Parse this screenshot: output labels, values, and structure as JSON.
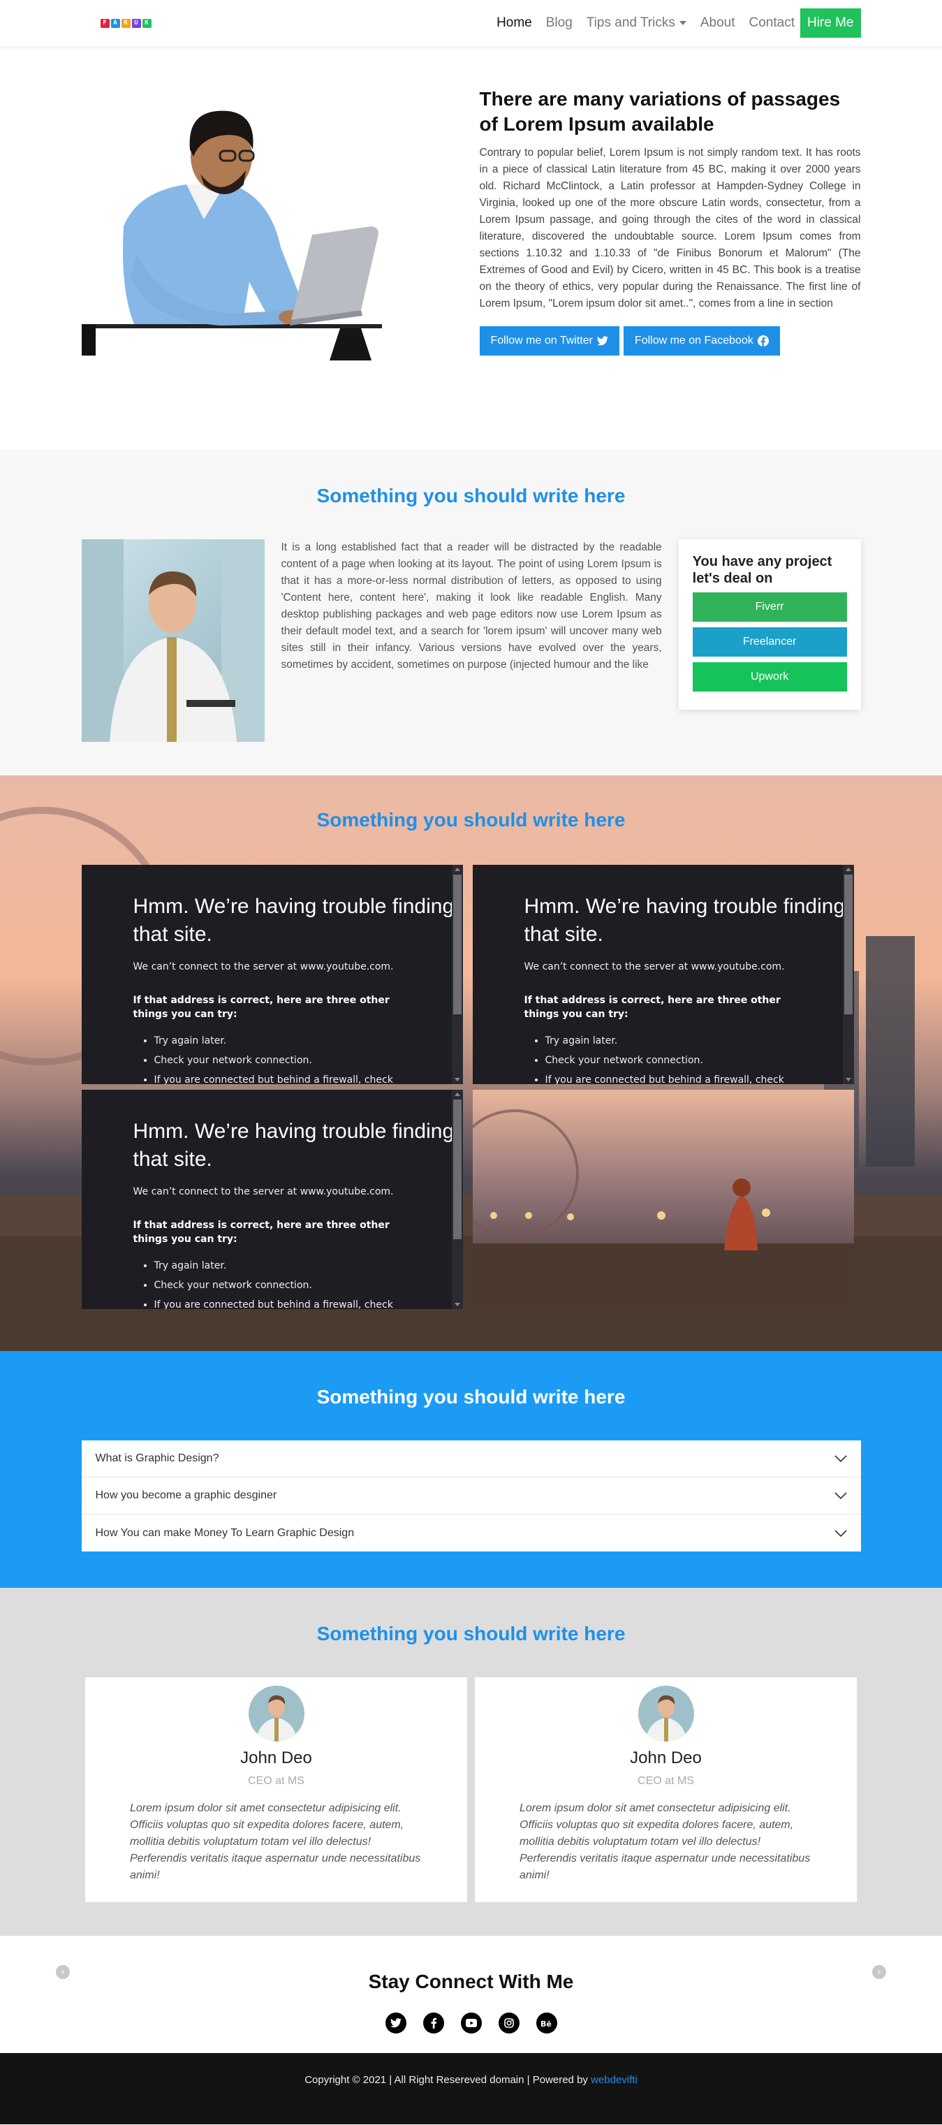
{
  "nav": {
    "logo_letters": [
      "F",
      "A",
      "R",
      "U",
      "K"
    ],
    "logo_colors": [
      "#e21f3c",
      "#1e90e8",
      "#f7a400",
      "#7a3cf0",
      "#20c25c"
    ],
    "links": [
      "Home",
      "Blog",
      "Tips and Tricks",
      "About",
      "Contact"
    ],
    "hire": "Hire Me"
  },
  "hero": {
    "title": "There are many variations of passages of Lorem Ipsum available",
    "paragraph": "Contrary to popular belief, Lorem Ipsum is not simply random text. It has roots in a piece of classical Latin literature from 45 BC, making it over 2000 years old. Richard McClintock, a Latin professor at Hampden-Sydney College in Virginia, looked up one of the more obscure Latin words, consectetur, from a Lorem Ipsum passage, and going through the cites of the word in classical literature, discovered the undoubtable source. Lorem Ipsum comes from sections 1.10.32 and 1.10.33 of \"de Finibus Bonorum et Malorum\" (The Extremes of Good and Evil) by Cicero, written in 45 BC. This book is a treatise on the theory of ethics, very popular during the Renaissance. The first line of Lorem Ipsum, \"Lorem ipsum dolor sit amet..\", comes from a line in section",
    "twitter_btn": "Follow me on Twitter",
    "facebook_btn": "Follow me on Facebook"
  },
  "section2": {
    "title": "Something you should write here",
    "paragraph": "It is a long established fact that a reader will be distracted by the readable content of a page when looking at its layout. The point of using Lorem Ipsum is that it has a more-or-less normal distribution of letters, as opposed to using 'Content here, content here', making it look like readable English. Many desktop publishing packages and web page editors now use Lorem Ipsum as their default model text, and a search for 'lorem ipsum' will uncover many web sites still in their infancy. Various versions have evolved over the years, sometimes by accident, sometimes on purpose (injected humour and the like",
    "deal_title": "You have any project let's deal on",
    "deal_buttons": [
      {
        "label": "Fiverr",
        "color": "#2fb35a"
      },
      {
        "label": "Freelancer",
        "color": "#1aa0c9"
      },
      {
        "label": "Upwork",
        "color": "#16c35a"
      }
    ]
  },
  "section3": {
    "title": "Something you should write here",
    "error": {
      "title": "Hmm. We’re having trouble finding that site.",
      "sub": "We can’t connect to the server at www.youtube.com.",
      "bold": "If that address is correct, here are three other things you can try:",
      "items": [
        "Try again later.",
        "Check your network connection.",
        "If you are connected but behind a firewall, check"
      ]
    }
  },
  "faq": {
    "title": "Something you should write here",
    "items": [
      "What is Graphic Design?",
      "How you become a graphic desginer",
      "How You can make Money To Learn Graphic Design"
    ]
  },
  "testimonials": {
    "title": "Something you should write here",
    "cards": [
      {
        "name": "John Deo",
        "role": "CEO at MS",
        "quote": "Lorem ipsum dolor sit amet consectetur adipisicing elit. Officiis voluptas quo sit expedita dolores facere, autem, mollitia debitis voluptatum totam vel illo delectus! Perferendis veritatis itaque aspernatur unde necessitatibus animi!"
      },
      {
        "name": "John Deo",
        "role": "CEO at MS",
        "quote": "Lorem ipsum dolor sit amet consectetur adipisicing elit. Officiis voluptas quo sit expedita dolores facere, autem, mollitia debitis voluptatum totam vel illo delectus! Perferendis veritatis itaque aspernatur unde necessitatibus animi!"
      }
    ]
  },
  "social": {
    "title": "Stay Connect With Me",
    "icons": [
      "twitter-icon",
      "facebook-icon",
      "youtube-icon",
      "instagram-icon",
      "behance-icon"
    ]
  },
  "footer": {
    "text": "Copyright © 2021 | All Right Resereved domain | Powered by",
    "link": "webdevifti"
  }
}
